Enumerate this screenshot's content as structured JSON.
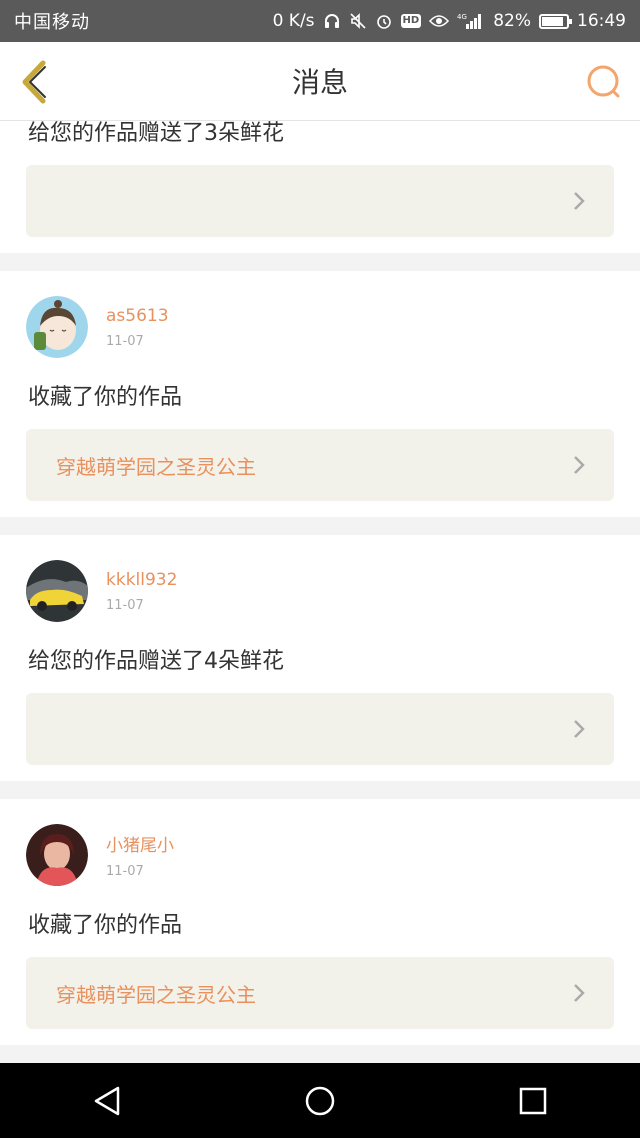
{
  "status_bar": {
    "carrier": "中国移动",
    "speed": "0 K/s",
    "battery": "82%",
    "time": "16:49",
    "network_badge": "HD",
    "net_type": "4G"
  },
  "header": {
    "title": "消息",
    "back_icon": "back-chevron-icon",
    "search_icon": "search-icon"
  },
  "colors": {
    "accent": "#e8915e",
    "back_icon": "#c6a93a",
    "search_icon": "#f3a56b",
    "work_box_bg": "#f3f2ea"
  },
  "messages": [
    {
      "text": "给您的作品赠送了3朵鲜花",
      "work_title": ""
    },
    {
      "username": "as5613",
      "date": "11-07",
      "text": "收藏了你的作品",
      "work_title": "穿越萌学园之圣灵公主"
    },
    {
      "username": "kkkll932",
      "date": "11-07",
      "text": "给您的作品赠送了4朵鲜花",
      "work_title": ""
    },
    {
      "username": "小猪尾小",
      "date": "11-07",
      "text": "收藏了你的作品",
      "work_title": "穿越萌学园之圣灵公主"
    }
  ],
  "navbar": {
    "back": "nav-back-icon",
    "home": "nav-home-icon",
    "recents": "nav-recents-icon"
  }
}
